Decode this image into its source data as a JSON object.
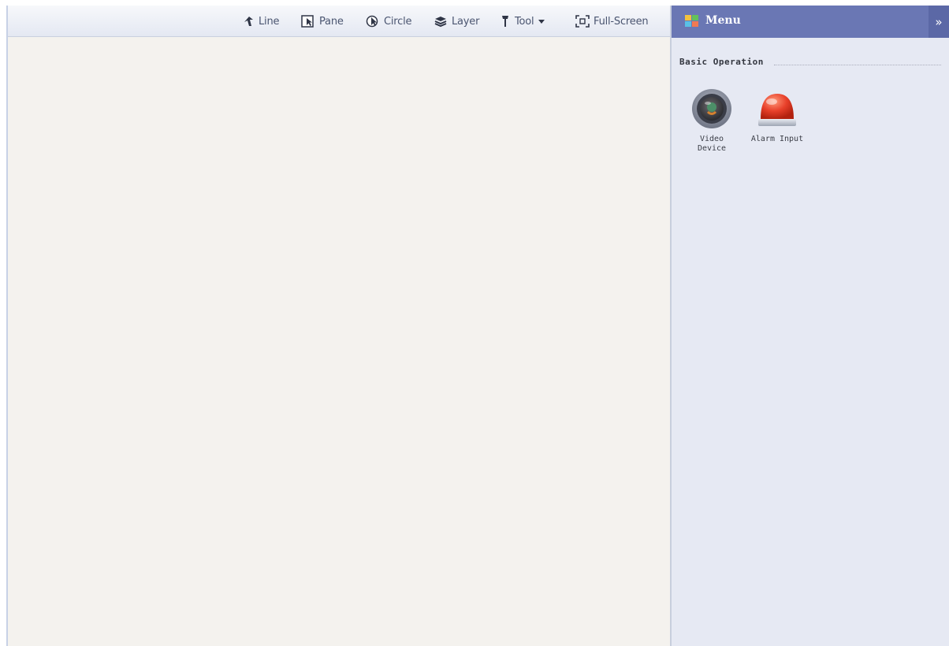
{
  "toolbar": {
    "items": [
      {
        "label": "Line",
        "icon": "line-cursor-icon"
      },
      {
        "label": "Pane",
        "icon": "pane-select-icon"
      },
      {
        "label": "Circle",
        "icon": "circle-select-icon"
      },
      {
        "label": "Layer",
        "icon": "layers-icon"
      },
      {
        "label": "Tool",
        "icon": "tool-icon"
      },
      {
        "label": "Full-Screen",
        "icon": "fullscreen-icon"
      }
    ]
  },
  "panel": {
    "title": "Menu",
    "collapse_label": "»",
    "section_title": "Basic Operation",
    "operations": [
      {
        "label": "Video\nDevice",
        "icon": "video-device-icon"
      },
      {
        "label": "Alarm Input",
        "icon": "alarm-input-icon"
      }
    ]
  },
  "colors": {
    "panel_header": "#6a77b4",
    "canvas_background": "#f4f2ee",
    "panel_background": "#e6e9f3",
    "toolbar_text": "#4a5570",
    "alarm_red": "#e8402a"
  }
}
